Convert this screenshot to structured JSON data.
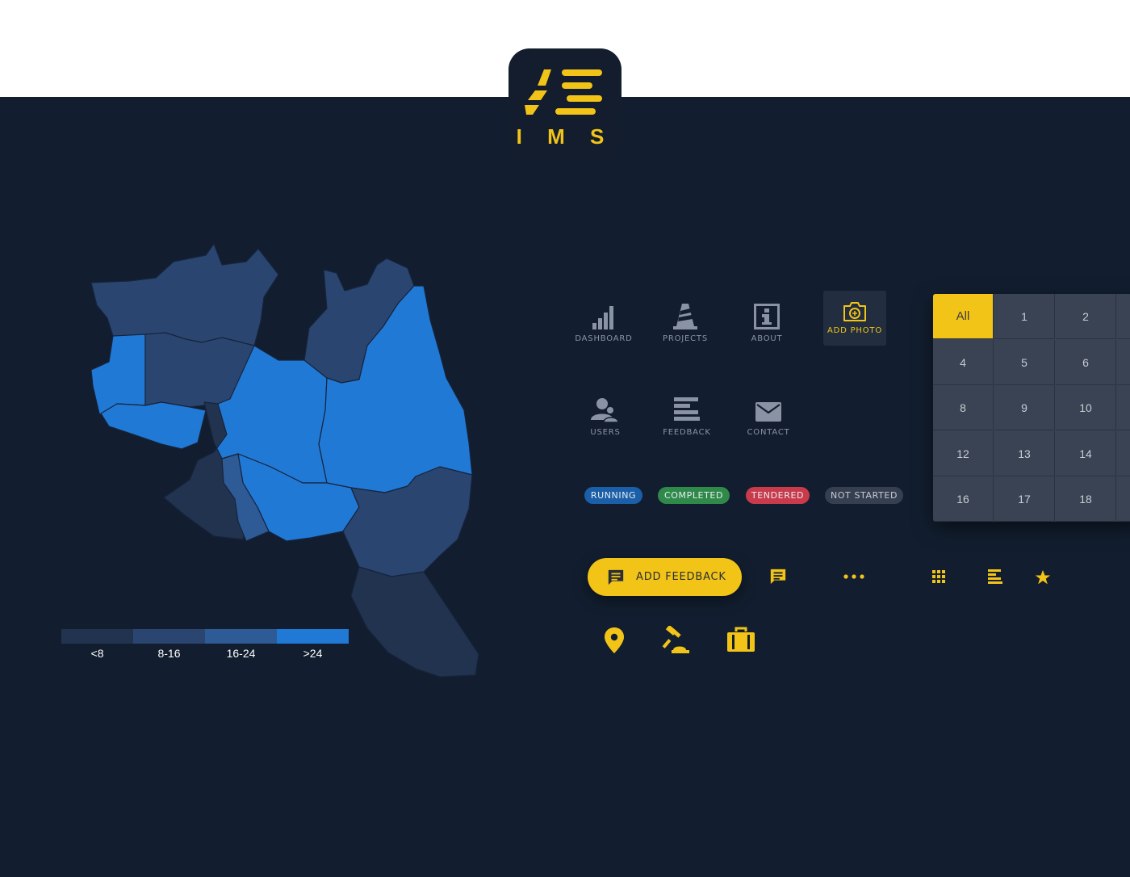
{
  "brand": {
    "app_name": "I M S",
    "accent": "#f2c417",
    "background": "#121e2f"
  },
  "map": {
    "legend": [
      {
        "label": "<8",
        "color": "#223350"
      },
      {
        "label": "8-16",
        "color": "#2a4670"
      },
      {
        "label": "16-24",
        "color": "#2e5a96"
      },
      {
        "label": ">24",
        "color": "#2179d6"
      }
    ]
  },
  "nav": {
    "dashboard": "DASHBOARD",
    "projects": "PROJECTS",
    "about": "ABOUT",
    "add_photo": "ADD PHOTO",
    "users": "USERS",
    "feedback": "FEEDBACK",
    "contact": "CONTACT"
  },
  "statuses": {
    "running": {
      "label": "RUNNING",
      "color": "#1a5fa8"
    },
    "completed": {
      "label": "COMPLETED",
      "color": "#2f8a4a"
    },
    "tendered": {
      "label": "TENDERED",
      "color": "#c93a4b"
    },
    "not_started": {
      "label": "NOT STARTED",
      "color": "#363f50"
    }
  },
  "number_grid": {
    "cells": [
      "All",
      "1",
      "2",
      "4",
      "5",
      "6",
      "8",
      "9",
      "10",
      "12",
      "13",
      "14",
      "16",
      "17",
      "18"
    ],
    "selected": "All"
  },
  "actions": {
    "add_feedback": "ADD FEEDBACK"
  },
  "icons": [
    "comment-icon",
    "more-icon",
    "grid-icon",
    "list-icon",
    "star-icon",
    "location-pin-icon",
    "gavel-icon",
    "briefcase-icon"
  ]
}
